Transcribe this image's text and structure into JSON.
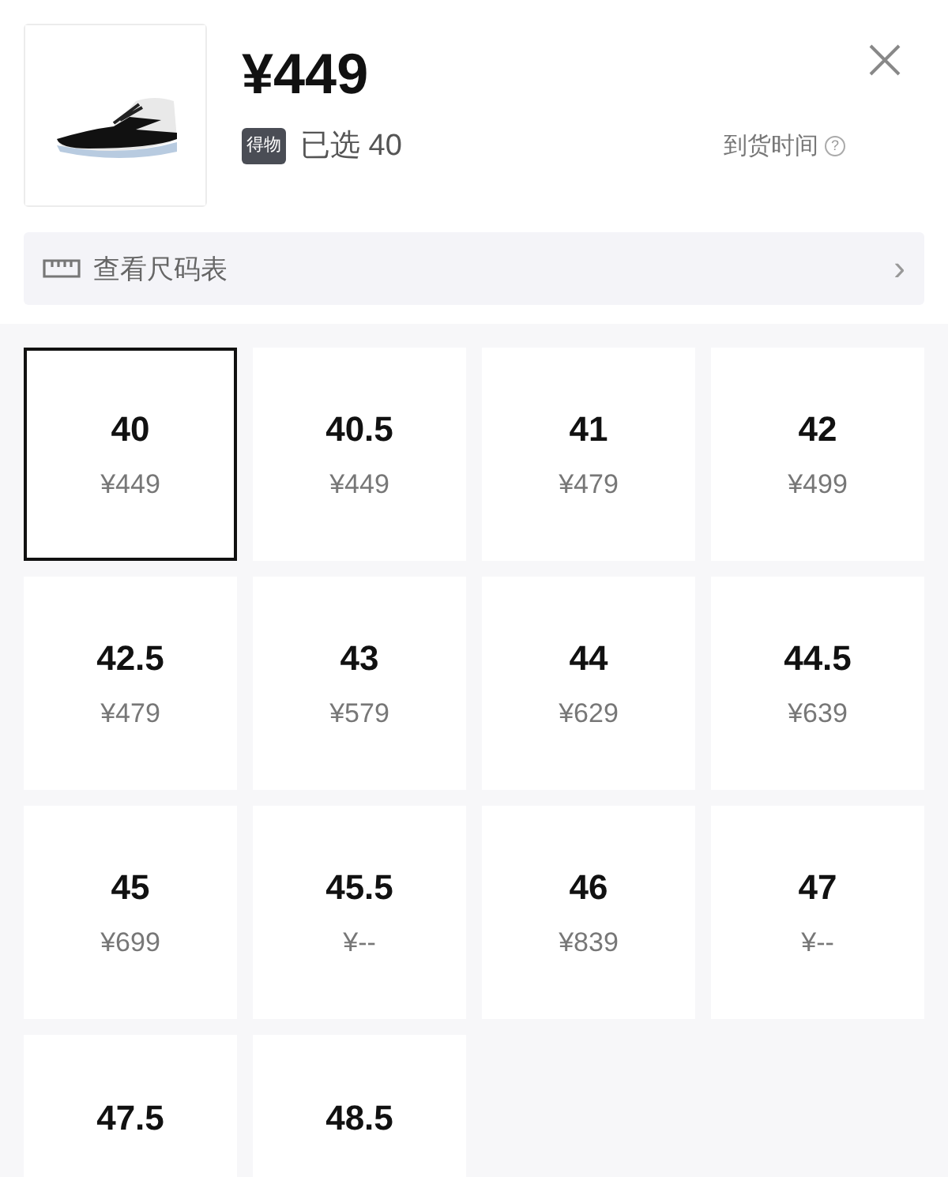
{
  "product": {
    "price": "¥449",
    "badge": "得物",
    "selected_label": "已选 40",
    "arrival_label": "到货时间",
    "help_mark": "?"
  },
  "size_chart": {
    "label": "查看尺码表",
    "chevron": "›"
  },
  "sizes": [
    {
      "size": "40",
      "price": "¥449",
      "selected": true
    },
    {
      "size": "40.5",
      "price": "¥449",
      "selected": false
    },
    {
      "size": "41",
      "price": "¥479",
      "selected": false
    },
    {
      "size": "42",
      "price": "¥499",
      "selected": false
    },
    {
      "size": "42.5",
      "price": "¥479",
      "selected": false
    },
    {
      "size": "43",
      "price": "¥579",
      "selected": false
    },
    {
      "size": "44",
      "price": "¥629",
      "selected": false
    },
    {
      "size": "44.5",
      "price": "¥639",
      "selected": false
    },
    {
      "size": "45",
      "price": "¥699",
      "selected": false
    },
    {
      "size": "45.5",
      "price": "¥--",
      "selected": false
    },
    {
      "size": "46",
      "price": "¥839",
      "selected": false
    },
    {
      "size": "47",
      "price": "¥--",
      "selected": false
    },
    {
      "size": "47.5",
      "selected": false
    },
    {
      "size": "48.5",
      "selected": false
    }
  ]
}
